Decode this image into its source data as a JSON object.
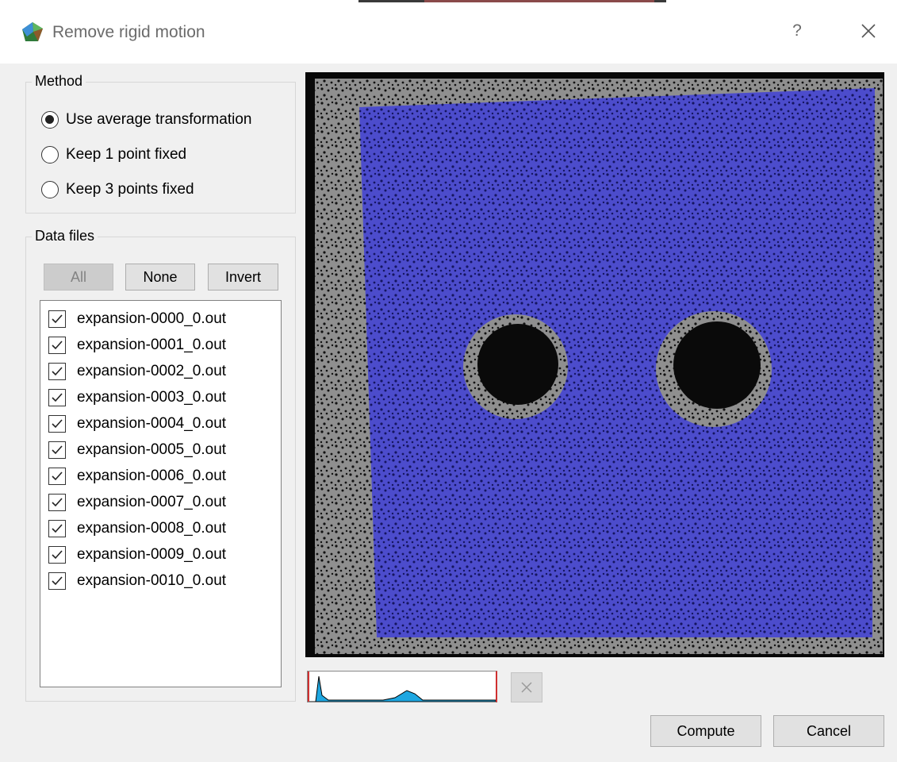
{
  "window": {
    "title": "Remove rigid motion",
    "help_label": "?"
  },
  "method_group": {
    "label": "Method",
    "options": [
      {
        "label": "Use average transformation",
        "checked": true
      },
      {
        "label": "Keep 1 point fixed",
        "checked": false
      },
      {
        "label": "Keep 3 points fixed",
        "checked": false
      }
    ]
  },
  "data_files_group": {
    "label": "Data files",
    "buttons": {
      "all": "All",
      "none": "None",
      "invert": "Invert"
    },
    "all_enabled": false,
    "files": [
      {
        "name": "expansion-0000_0.out",
        "checked": true
      },
      {
        "name": "expansion-0001_0.out",
        "checked": true
      },
      {
        "name": "expansion-0002_0.out",
        "checked": true
      },
      {
        "name": "expansion-0003_0.out",
        "checked": true
      },
      {
        "name": "expansion-0004_0.out",
        "checked": true
      },
      {
        "name": "expansion-0005_0.out",
        "checked": true
      },
      {
        "name": "expansion-0006_0.out",
        "checked": true
      },
      {
        "name": "expansion-0007_0.out",
        "checked": true
      },
      {
        "name": "expansion-0008_0.out",
        "checked": true
      },
      {
        "name": "expansion-0009_0.out",
        "checked": true
      },
      {
        "name": "expansion-0010_0.out",
        "checked": true
      }
    ]
  },
  "image_view": {
    "overlay_color": "#4c4ccc",
    "speckle_background": "#8f8f8f"
  },
  "histogram": {
    "fill_color": "#1ea7e1",
    "clip_marker_color": "#d03030"
  },
  "actions": {
    "compute": "Compute",
    "cancel": "Cancel"
  }
}
